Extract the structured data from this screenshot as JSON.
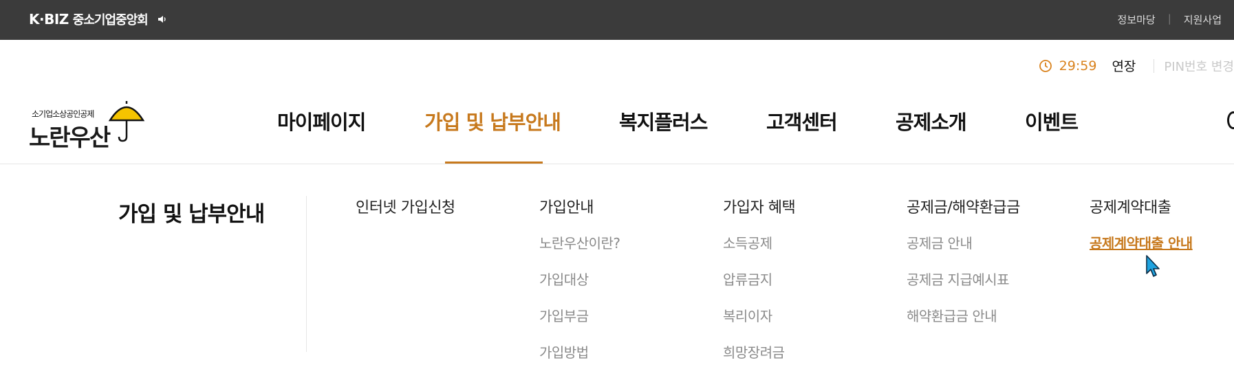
{
  "topbar": {
    "brand_mark": "K·BIZ",
    "brand_name": "중소기업중앙회",
    "links": [
      "정보마당",
      "지원사업"
    ]
  },
  "session": {
    "timer": "29:59",
    "extend_label": "연장",
    "pin_label": "PIN번호 변경"
  },
  "logo": {
    "subtitle": "소기업소상공인공제",
    "main": "노란우산"
  },
  "gnb": {
    "items": [
      "마이페이지",
      "가입 및 납부안내",
      "복지플러스",
      "고객센터",
      "공제소개",
      "이벤트"
    ],
    "active_index": 1
  },
  "submenu": {
    "title": "가입 및 납부안내",
    "columns": [
      {
        "head": "인터넷 가입신청",
        "items": []
      },
      {
        "head": "가입안내",
        "items": [
          "노란우산이란?",
          "가입대상",
          "가입부금",
          "가입방법"
        ]
      },
      {
        "head": "가입자 혜택",
        "items": [
          "소득공제",
          "압류금지",
          "복리이자",
          "희망장려금"
        ]
      },
      {
        "head": "공제금/해약환급금",
        "items": [
          "공제금 안내",
          "공제금 지급예시표",
          "해약환급금 안내"
        ]
      },
      {
        "head": "공제계약대출",
        "items": [
          "공제계약대출 안내"
        ]
      }
    ]
  },
  "colors": {
    "accent": "#c7791d",
    "topbar_bg": "#3b3b3b",
    "umbrella_yellow": "#f5c400"
  }
}
